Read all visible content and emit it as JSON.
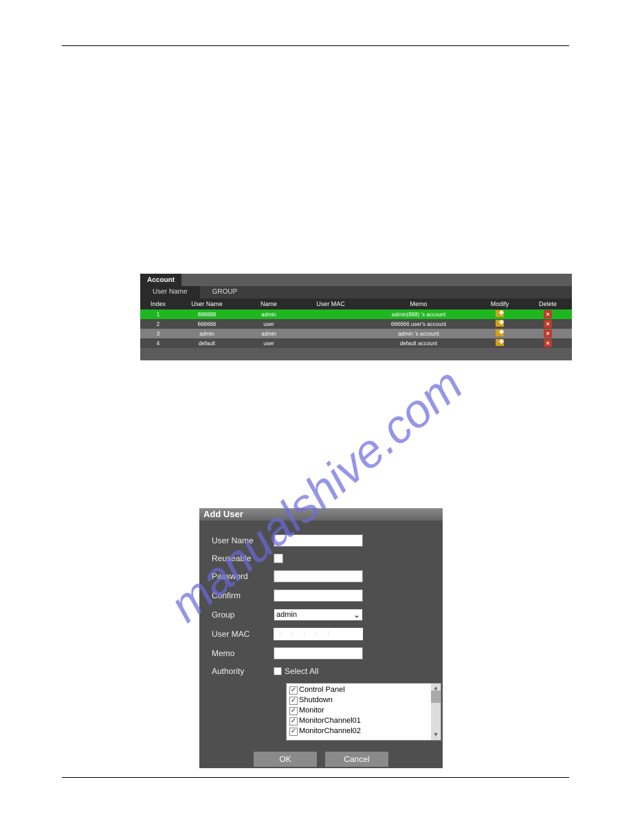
{
  "watermark": "manualshive.com",
  "account_panel": {
    "title": "Account",
    "tabs": {
      "user": "User Name",
      "group": "GROUP"
    },
    "headers": {
      "index": "Index",
      "username": "User Name",
      "name": "Name",
      "usermac": "User MAC",
      "memo": "Memo",
      "modify": "Modify",
      "delete": "Delete"
    },
    "rows": [
      {
        "index": "1",
        "username": "888888",
        "name": "admin",
        "usermac": "",
        "memo": "admin(888) 's account"
      },
      {
        "index": "2",
        "username": "666666",
        "name": "user",
        "usermac": "",
        "memo": "666666 user's account"
      },
      {
        "index": "3",
        "username": "admin",
        "name": "admin",
        "usermac": "",
        "memo": "admin 's account"
      },
      {
        "index": "4",
        "username": "default",
        "name": "user",
        "usermac": "",
        "memo": "default account"
      }
    ]
  },
  "add_user": {
    "title": "Add User",
    "labels": {
      "username": "User Name",
      "reuseable": "Reuseable",
      "password": "Password",
      "confirm": "Confirm",
      "group": "Group",
      "usermac": "User MAC",
      "memo": "Memo",
      "authority": "Authority",
      "select_all": "Select All"
    },
    "group_value": "admin",
    "mac_placeholder": ": : : : :",
    "authority_items": [
      "Control Panel",
      "Shutdown",
      "Monitor",
      "MonitorChannel01",
      "MonitorChannel02"
    ],
    "buttons": {
      "ok": "OK",
      "cancel": "Cancel"
    }
  }
}
